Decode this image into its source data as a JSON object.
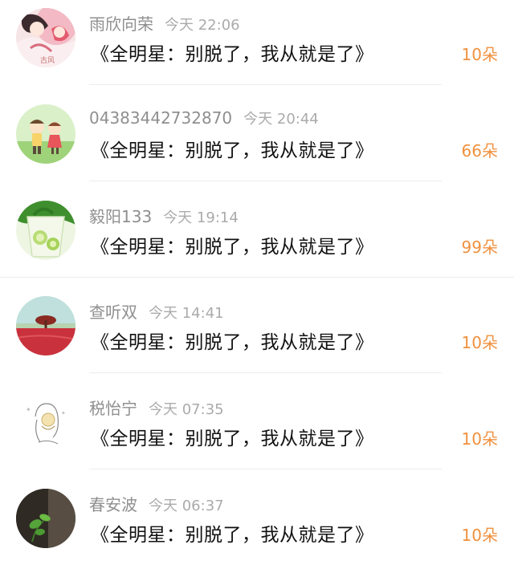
{
  "comments": [
    {
      "username": "雨欣向荣",
      "time": "今天 22:06",
      "title": "《全明星：别脱了，我从就是了》",
      "gift": "10朵",
      "avatar": "avatar-anime-couple",
      "avatar_text": "古风"
    },
    {
      "username": "04383442732870",
      "time": "今天 20:44",
      "title": "《全明星：别脱了，我从就是了》",
      "gift": "66朵",
      "avatar": "avatar-cartoon-kids"
    },
    {
      "username": "毅阳133",
      "time": "今天 19:14",
      "title": "《全明星：别脱了，我从就是了》",
      "gift": "99朵",
      "avatar": "avatar-lime-drink"
    },
    {
      "username": "查听双",
      "time": "今天 14:41",
      "title": "《全明星：别脱了，我从就是了》",
      "gift": "10朵",
      "avatar": "avatar-red-field-tree"
    },
    {
      "username": "税怡宁",
      "time": "今天 07:35",
      "title": "《全明星：别脱了，我从就是了》",
      "gift": "10朵",
      "avatar": "avatar-sketch-girl"
    },
    {
      "username": "春安波",
      "time": "今天 06:37",
      "title": "《全明星：别脱了，我从就是了》",
      "gift": "10朵",
      "avatar": "avatar-green-plant"
    }
  ],
  "colors": {
    "gift": "#f0913f",
    "username": "#8f8f8f",
    "time": "#ababab",
    "title": "#111111",
    "divider": "#ededed"
  }
}
